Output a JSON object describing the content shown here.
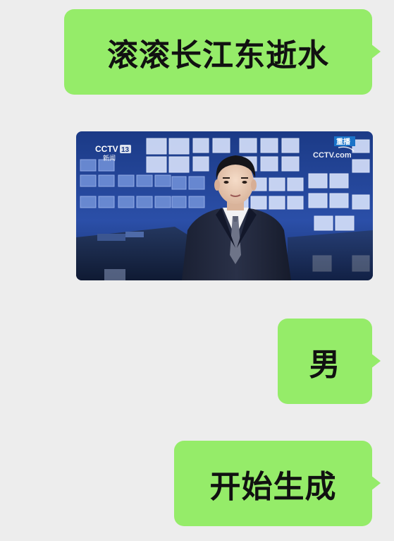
{
  "messages": [
    {
      "type": "text",
      "side": "right",
      "text": "滚滚长江东逝水"
    },
    {
      "type": "image",
      "side": "right",
      "image": {
        "channel_logo": "CCTV",
        "channel_number": "13",
        "channel_sub": "新闻",
        "rebroadcast_badge": "重播",
        "watermark": "CCTV.com",
        "watermark_icon": "cctv-com-logo-icon"
      }
    },
    {
      "type": "text",
      "side": "right",
      "text": "男"
    },
    {
      "type": "text",
      "side": "right",
      "text": "开始生成"
    }
  ],
  "colors": {
    "background": "#ededed",
    "bubble": "#95ec69",
    "text": "#111111"
  }
}
